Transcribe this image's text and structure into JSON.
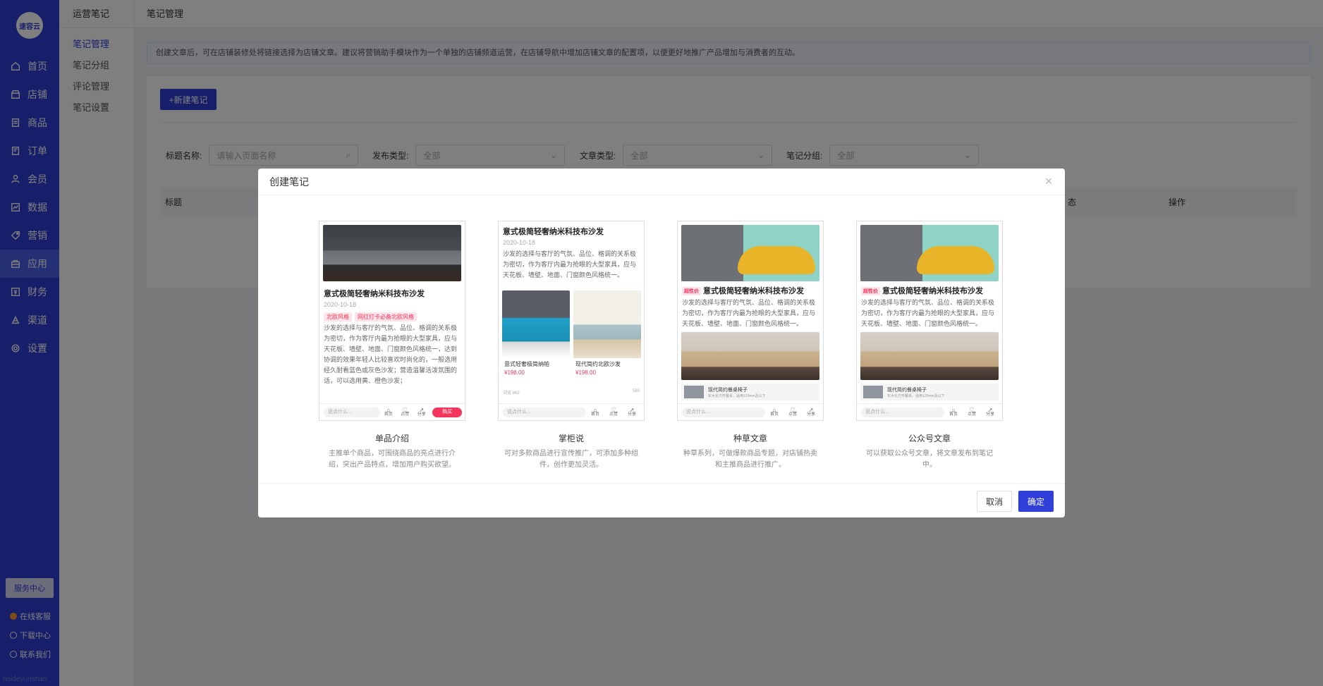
{
  "sidebar": {
    "logo": "速容云",
    "items": [
      {
        "label": "首页",
        "icon": "home-icon"
      },
      {
        "label": "店铺",
        "icon": "store-icon"
      },
      {
        "label": "商品",
        "icon": "goods-icon"
      },
      {
        "label": "订单",
        "icon": "order-icon"
      },
      {
        "label": "会员",
        "icon": "member-icon"
      },
      {
        "label": "数据",
        "icon": "chart-icon"
      },
      {
        "label": "营销",
        "icon": "tag-icon"
      },
      {
        "label": "应用",
        "icon": "app-icon"
      },
      {
        "label": "财务",
        "icon": "finance-icon"
      },
      {
        "label": "渠道",
        "icon": "channel-icon"
      },
      {
        "label": "设置",
        "icon": "gear-icon"
      }
    ],
    "service_center": "服务中心",
    "footer_links": [
      "在线客服",
      "下载中心",
      "联系我们"
    ],
    "watermark": "haideyunshan"
  },
  "subnav": {
    "title": "运营笔记",
    "items": [
      "笔记管理",
      "笔记分组",
      "评论管理",
      "笔记设置"
    ]
  },
  "topbar": {
    "breadcrumb": "笔记管理"
  },
  "notice": "创建文章后，可在店铺装修处将链接选择为店铺文章。建议将营销助手模块作为一个单独的店铺频道运营，在店铺导航中增加店铺文章的配置项，以便更好地推广产品增加与消费者的互动。",
  "toolbar": {
    "new_note": "+新建笔记"
  },
  "filters": [
    {
      "label": "标题名称:",
      "value": "请输入页面名称",
      "type": "search"
    },
    {
      "label": "发布类型:",
      "value": "全部",
      "type": "select"
    },
    {
      "label": "文章类型:",
      "value": "全部",
      "type": "select"
    },
    {
      "label": "笔记分组:",
      "value": "全部",
      "type": "select"
    }
  ],
  "table": {
    "headers": [
      "标题",
      "态",
      "操作"
    ]
  },
  "modal": {
    "title": "创建笔记",
    "cancel": "取消",
    "confirm": "确定",
    "options": [
      {
        "name": "单品介绍",
        "desc": "主推单个商品，可围绕商品的亮点进行介绍，突出产品特点，增加用户购买欲望。",
        "preview": {
          "title": "意式极简轻奢纳米科技布沙发",
          "date": "2020-10-18",
          "tags": [
            "北欧风格",
            "网红打卡必备北欧风格"
          ],
          "text": "沙发的选择与客厅的气氛、品位、格调的关系极为密切，作为客厅内最为抢眼的大型家具，应与天花板、墙壁、地面、门窗颜色风格统一，达到协调的效果年轻人比较喜欢时尚化的，一般选用经久耐看蓝色或灰色沙发；营造温馨活泼氛围的话，可以选用黄、橙色沙发；",
          "input": "说点什么...",
          "icons": [
            "首页",
            "点赞",
            "分享"
          ],
          "buy": "购买"
        }
      },
      {
        "name": "掌柜说",
        "desc": "可对多款商品进行宣传推广，可添加多种组件，创作更加灵活。",
        "preview": {
          "title": "意式极简轻奢纳米科技布沙发",
          "date": "2020-10-18",
          "text": "沙发的选择与客厅的气氛、品位、格调的关系极为密切，作为客厅内最为抢眼的大型家具，应与天花板、墙壁、地面、门窗颜色风格统一。",
          "products": [
            {
              "name": "意式轻奢极简纳帕",
              "price": "¥198.00"
            },
            {
              "name": "现代简约北欧沙发",
              "price": "¥198.00"
            }
          ],
          "views": "浏览 862",
          "likes": "580",
          "input": "说点什么...",
          "icons": [
            "首页",
            "点赞",
            "分享"
          ]
        }
      },
      {
        "name": "种草文章",
        "desc": "种草系列，可做爆款商品专题，对店铺热卖和主推商品进行推广。",
        "preview": {
          "tag": "超性价",
          "title": "意式极简轻奢纳米科技布沙发",
          "text": "沙发的选择与客厅的气氛、品位、格调的关系极为密切，作为客厅内最为抢眼的大型家具，应与天花板、墙壁、地面、门窗颜色风格统一。",
          "product_name": "现代简约餐桌椅子",
          "product_sub": "实木长方形餐桌，适用120mm及以下",
          "input": "说点什么...",
          "icons": [
            "首页",
            "点赞",
            "分享"
          ]
        }
      },
      {
        "name": "公众号文章",
        "desc": "可以获取公众号文章，将文章发布到笔记中。",
        "preview": {
          "tag": "超性价",
          "title": "意式极简轻奢纳米科技布沙发",
          "text": "沙发的选择与客厅的气氛、品位、格调的关系极为密切，作为客厅内最为抢眼的大型家具，应与天花板、墙壁、地面、门窗颜色风格统一。",
          "product_name": "现代简约餐桌椅子",
          "product_sub": "实木长方形餐桌，适用120mm及以下",
          "input": "说点什么...",
          "icons": [
            "首页",
            "点赞",
            "分享"
          ]
        }
      }
    ]
  },
  "colors": {
    "primary": "#2f3fd7",
    "accent": "#f5365c"
  }
}
